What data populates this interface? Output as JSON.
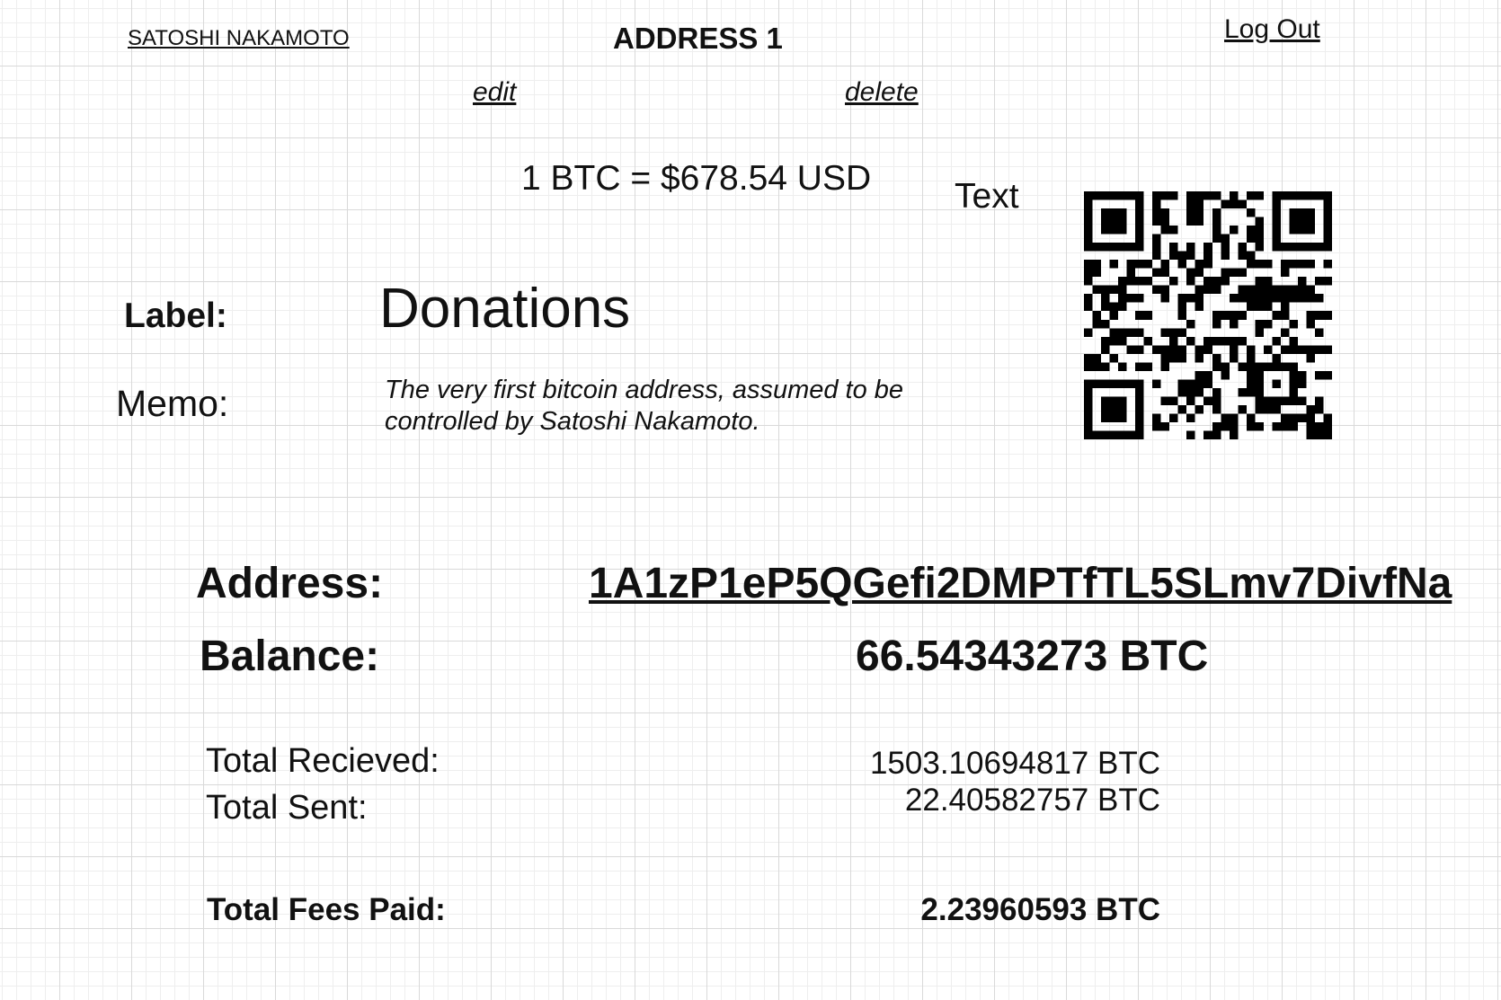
{
  "header": {
    "user_name": "SATOSHI NAKAMOTO",
    "title": "ADDRESS 1",
    "logout_label": "Log Out"
  },
  "actions": {
    "edit_label": "edit",
    "delete_label": "delete"
  },
  "exchange_rate": "1 BTC = $678.54 USD",
  "qr": {
    "caption": "Text",
    "icon": "qr-code-icon",
    "color": "#000000"
  },
  "details": {
    "label_key": "Label:",
    "label_value": "Donations",
    "memo_key": "Memo:",
    "memo_value": "The very first bitcoin address, assumed to be controlled by Satoshi Nakamoto."
  },
  "summary": {
    "address_key": "Address:",
    "address_value": "1A1zP1eP5QGefi2DMPTfTL5SLmv7DivfNa",
    "balance_key": "Balance:",
    "balance_value": "66.54343273 BTC"
  },
  "totals": {
    "received_key": "Total Recieved:",
    "received_value": "1503.10694817 BTC",
    "sent_key": "Total Sent:",
    "sent_value": "22.40582757 BTC",
    "fees_key": "Total Fees Paid:",
    "fees_value": "2.23960593 BTC"
  }
}
